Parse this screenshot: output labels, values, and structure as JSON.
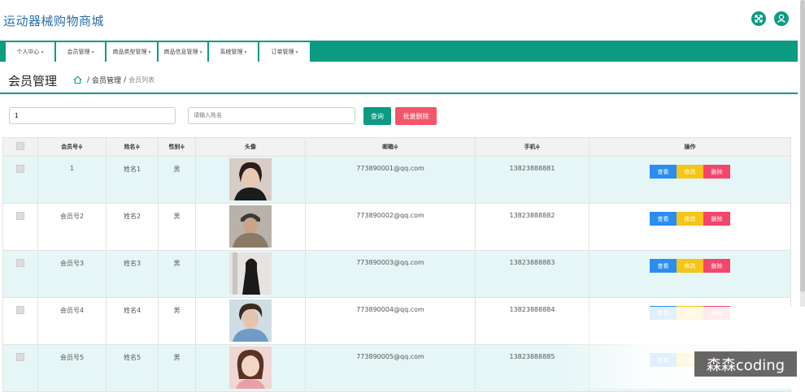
{
  "header": {
    "title": "运动器械购物商城",
    "fullscreen_icon": "expand-icon",
    "user_icon": "user-icon"
  },
  "nav": [
    {
      "label": "个人中心"
    },
    {
      "label": "会员管理"
    },
    {
      "label": "商品类型管理"
    },
    {
      "label": "商品信息管理"
    },
    {
      "label": "系统管理"
    },
    {
      "label": "订单管理"
    }
  ],
  "page": {
    "title": "会员管理",
    "crumb_parent": "会员管理",
    "crumb_current": "会员列表"
  },
  "search": {
    "value": "1",
    "name_placeholder": "请输入姓名",
    "query_label": "查询",
    "batch_delete_label": "批量删除"
  },
  "table": {
    "headers": [
      "会员号≑",
      "姓名≑",
      "性别≑",
      "头像",
      "邮箱≑",
      "手机≑",
      "操作"
    ],
    "rows": [
      {
        "id": "1",
        "name": "姓名1",
        "gender": "男",
        "email": "773890001@qq.com",
        "phone": "13823888881"
      },
      {
        "id": "会员号2",
        "name": "姓名2",
        "gender": "男",
        "email": "773890002@qq.com",
        "phone": "13823888882"
      },
      {
        "id": "会员号3",
        "name": "姓名3",
        "gender": "男",
        "email": "773890003@qq.com",
        "phone": "13823888883"
      },
      {
        "id": "会员号4",
        "name": "姓名4",
        "gender": "男",
        "email": "773890004@qq.com",
        "phone": "13823888884"
      },
      {
        "id": "会员号5",
        "name": "姓名5",
        "gender": "男",
        "email": "773890005@qq.com",
        "phone": "13823888885"
      }
    ],
    "actions": {
      "view": "查看",
      "edit": "修改",
      "delete": "删除"
    }
  },
  "watermark": "森森coding",
  "colors": {
    "primary": "#0a9b82",
    "danger": "#f4556b",
    "view": "#2b8cf2",
    "edit": "#f5c518"
  }
}
